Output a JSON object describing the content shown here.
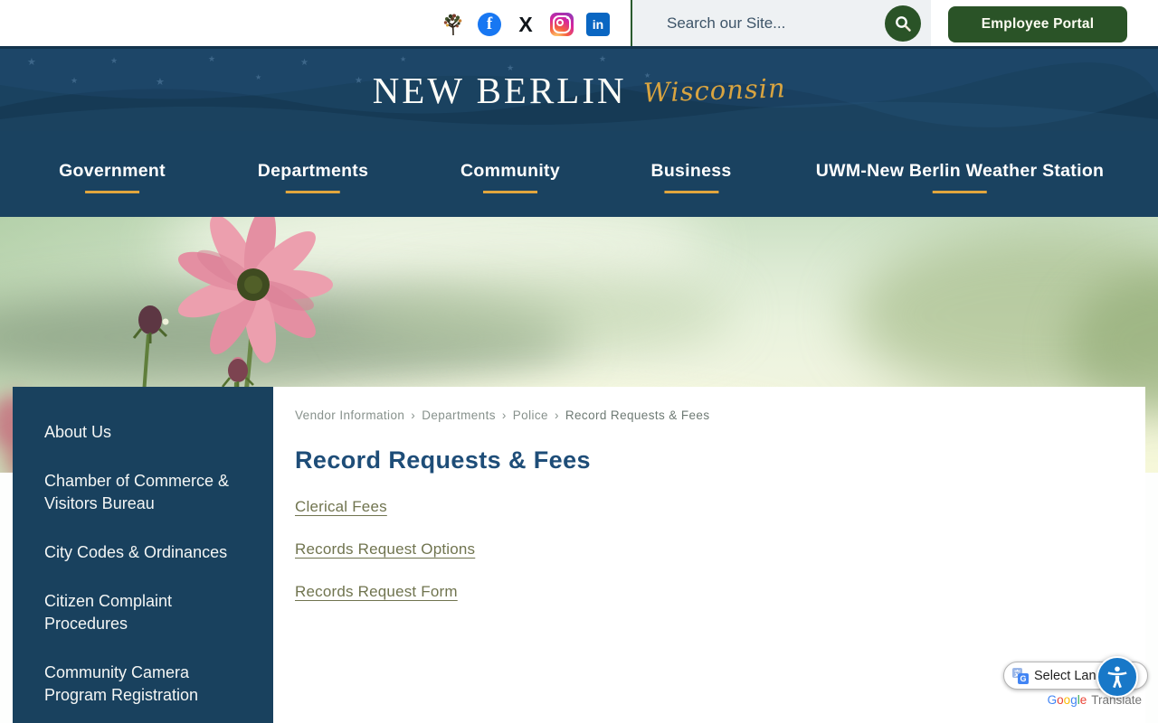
{
  "topbar": {
    "search_placeholder": "Search our Site...",
    "employee_portal_label": "Employee Portal",
    "social_icons": [
      "city-tree-icon",
      "facebook-icon",
      "x-icon",
      "instagram-icon",
      "linkedin-icon"
    ],
    "facebook_glyph": "f",
    "x_glyph": "X",
    "linkedin_glyph": "in"
  },
  "header": {
    "city": "NEW BERLIN",
    "state": "Wisconsin"
  },
  "nav": {
    "items": [
      {
        "label": "Government"
      },
      {
        "label": "Departments"
      },
      {
        "label": "Community"
      },
      {
        "label": "Business"
      },
      {
        "label": "UWM-New Berlin Weather Station"
      }
    ]
  },
  "sidebar": {
    "items": [
      {
        "label": "About Us"
      },
      {
        "label": "Chamber of Commerce & Visitors Bureau"
      },
      {
        "label": "City Codes & Ordinances"
      },
      {
        "label": "Citizen Complaint Procedures"
      },
      {
        "label": "Community Camera Program Registration"
      }
    ]
  },
  "breadcrumb": {
    "separator": "›",
    "items": [
      {
        "label": "Vendor Information"
      },
      {
        "label": "Departments"
      },
      {
        "label": "Police"
      },
      {
        "label": "Record Requests & Fees"
      }
    ]
  },
  "main": {
    "title": "Record Requests & Fees",
    "links": [
      {
        "label": "Clerical Fees"
      },
      {
        "label": "Records Request Options"
      },
      {
        "label": "Records Request Form"
      }
    ]
  },
  "translate": {
    "select_label": "Select Langu",
    "caret": "▾",
    "google_letters": [
      "G",
      "o",
      "o",
      "g",
      "l",
      "e"
    ],
    "translate_label": "Translate"
  },
  "colors": {
    "navy": "#1a4260",
    "gold": "#e2a63d",
    "button_green": "#2a5327",
    "heading_blue": "#1e4d78",
    "link_olive": "#70744f"
  }
}
